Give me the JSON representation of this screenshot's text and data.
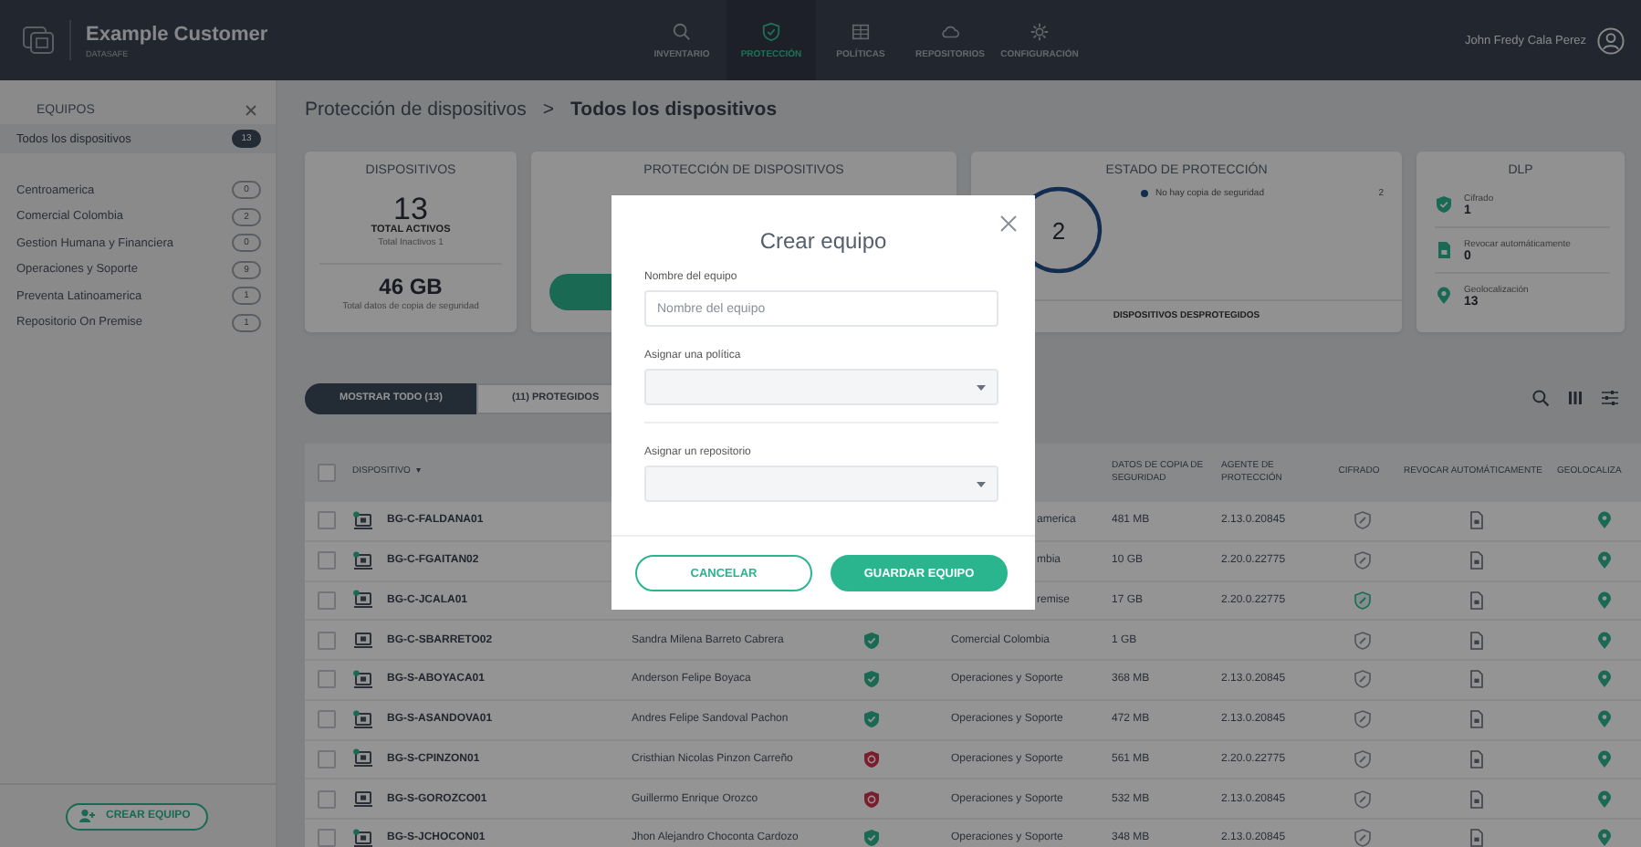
{
  "topbar": {
    "brand": "Example Customer",
    "subtitle": "DATASAFE",
    "user": "John Fredy Cala Perez",
    "nav": [
      {
        "label": "INVENTARIO",
        "selected": false
      },
      {
        "label": "PROTECCIÓN",
        "selected": true
      },
      {
        "label": "POLÍTICAS",
        "selected": false
      },
      {
        "label": "REPOSITORIOS",
        "selected": false
      },
      {
        "label": "CONFIGURACIÓN",
        "selected": false
      }
    ]
  },
  "sidebar": {
    "title": "EQUIPOS",
    "all": {
      "label": "Todos los dispositivos",
      "count": "13",
      "selected": true
    },
    "teams": [
      {
        "label": "Centroamerica",
        "count": "0",
        "selected": false
      },
      {
        "label": "Comercial Colombia",
        "count": "2",
        "selected": false
      },
      {
        "label": "Gestion Humana y Financiera",
        "count": "0",
        "selected": false
      },
      {
        "label": "Operaciones y Soporte",
        "count": "9",
        "selected": false
      },
      {
        "label": "Preventa Latinoamerica",
        "count": "1",
        "selected": false
      },
      {
        "label": "Repositorio On Premise",
        "count": "1",
        "selected": false
      }
    ],
    "create_button": "CREAR EQUIPO"
  },
  "breadcrumb": {
    "parent": "Protección de dispositivos",
    "separator": ">",
    "current": "Todos los dispositivos"
  },
  "cards": {
    "devices": {
      "title": "DISPOSITIVOS",
      "active": "13",
      "active_label": "TOTAL ACTIVOS",
      "inactive": "Total Inactivos 1",
      "backup": "46 GB",
      "backup_label": "Total datos de copia de seguridad"
    },
    "protection": {
      "title": "PROTECCIÓN DE DISPOSITIVOS"
    },
    "status": {
      "title": "ESTADO DE PROTECCIÓN",
      "center": "2",
      "legend": [
        {
          "label": "No hay copia de seguridad",
          "count": "2"
        }
      ],
      "footer": "DISPOSITIVOS DESPROTEGIDOS"
    },
    "dlp": {
      "title": "DLP",
      "items": [
        {
          "kind": "shield",
          "label": "Cifrado",
          "value": "1"
        },
        {
          "kind": "file",
          "label": "Revocar automáticamente",
          "value": "0"
        },
        {
          "kind": "pin",
          "label": "Geolocalización",
          "value": "13"
        }
      ]
    }
  },
  "filters": [
    {
      "label": "MOSTRAR TODO (13)",
      "selected": true
    },
    {
      "label": "(11) PROTEGIDOS",
      "selected": false
    }
  ],
  "table": {
    "all_checked": false,
    "columns": [
      {
        "label": "DISPOSITIVO",
        "sort_mark": "▾"
      },
      {
        "label": "DATOS DE COPIA DE SEGURIDAD"
      },
      {
        "label": "AGENTE DE PROTECCIÓN"
      },
      {
        "label": "CIFRADO"
      },
      {
        "label": "REVOCAR AUTOMÁTICAMENTE"
      },
      {
        "label": "GEOLOCALIZA"
      }
    ],
    "rows": [
      {
        "checked": false,
        "device": "BG-C-FALDANA01",
        "online": true,
        "team": "america",
        "data": "481 MB",
        "agent": "2.13.0.20845",
        "encrypted": false
      },
      {
        "checked": false,
        "device": "BG-C-FGAITAN02",
        "online": true,
        "team": "mbia",
        "data": "10 GB",
        "agent": "2.20.0.22775",
        "encrypted": false
      },
      {
        "checked": false,
        "device": "BG-C-JCALA01",
        "online": true,
        "team": "remise",
        "data": "17 GB",
        "agent": "2.20.0.22775",
        "encrypted": true
      },
      {
        "checked": false,
        "device": "BG-C-SBARRETO02",
        "online": false,
        "user": "Sandra Milena Barreto Cabrera",
        "protected": true,
        "team": "Comercial Colombia",
        "data": "1 GB",
        "encrypted": false
      },
      {
        "checked": false,
        "device": "BG-S-ABOYACA01",
        "online": true,
        "user": "Anderson Felipe Boyaca",
        "protected": true,
        "team": "Operaciones y Soporte",
        "data": "368 MB",
        "agent": "2.13.0.20845",
        "encrypted": false
      },
      {
        "checked": false,
        "device": "BG-S-ASANDOVA01",
        "online": true,
        "user": "Andres Felipe Sandoval Pachon",
        "protected": true,
        "team": "Operaciones y Soporte",
        "data": "472 MB",
        "agent": "2.13.0.20845",
        "encrypted": false
      },
      {
        "checked": false,
        "device": "BG-S-CPINZON01",
        "online": true,
        "user": "Cristhian Nicolas Pinzon Carreño",
        "protected": false,
        "team": "Operaciones y Soporte",
        "data": "561 MB",
        "agent": "2.20.0.22775",
        "encrypted": false
      },
      {
        "checked": false,
        "device": "BG-S-GOROZCO01",
        "online": false,
        "user": "Guillermo Enrique Orozco",
        "protected": false,
        "team": "Operaciones y Soporte",
        "data": "532 MB",
        "agent": "2.13.0.20845",
        "encrypted": false
      },
      {
        "checked": false,
        "device": "BG-S-JCHOCON01",
        "online": true,
        "user": "Jhon Alejandro Choconta Cardozo",
        "protected": true,
        "team": "Operaciones y Soporte",
        "data": "348 MB",
        "agent": "2.13.0.20845",
        "encrypted": false
      }
    ]
  },
  "modal": {
    "title": "Crear equipo",
    "fields": [
      {
        "kind": "text",
        "label": "Nombre del equipo",
        "placeholder": "Nombre del equipo"
      },
      {
        "kind": "select",
        "label": "Asignar una política"
      },
      {
        "kind": "select",
        "label": "Asignar un repositorio"
      }
    ],
    "cancel": "CANCELAR",
    "save": "GUARDAR EQUIPO"
  }
}
